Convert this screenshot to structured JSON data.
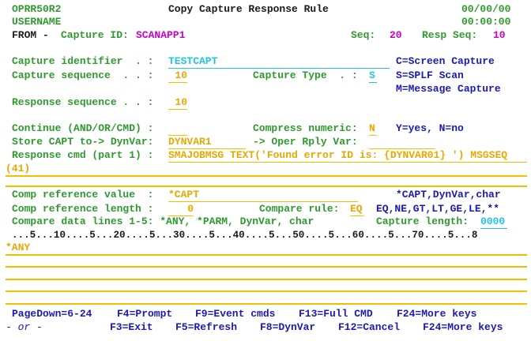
{
  "header": {
    "program": "OPRR50R2",
    "user": "USERNAME",
    "title": "Copy Capture Response Rule",
    "date": "00/00/00",
    "time": "00:00:00"
  },
  "from": {
    "label": "FROM -",
    "capture_id_label": "Capture ID:",
    "capture_id": "SCANAPP1",
    "seq_label": "Seq:",
    "seq": "20",
    "resp_seq_label": "Resp Seq:",
    "resp_seq": "10"
  },
  "fields": {
    "capture_identifier_label": "Capture identifier  . :",
    "capture_identifier": "TESTCAPT",
    "capture_sequence_label": "Capture sequence  . . :",
    "capture_sequence": "10",
    "capture_type_label": "Capture Type  . :",
    "capture_type": "S",
    "response_sequence_label": "Response sequence . . :",
    "response_sequence": "10",
    "continue_label": "Continue (AND/OR/CMD) :",
    "continue_value": "",
    "compress_label": "Compress numeric:",
    "compress_value": "N",
    "compress_hint": "Y=yes, N=no",
    "store_capt_label": "Store CAPT to-> DynVar:",
    "store_capt_value": "DYNVAR1",
    "oper_rply_label": "-> Oper Rply Var:",
    "oper_rply_value": "",
    "response_cmd_label": "Response cmd (part 1) :",
    "response_cmd_line1": "SMAJOBMSG TEXT('Found error ID is: {DYNVAR01} ') MSGSEQ",
    "response_cmd_line2": "(41)",
    "comp_ref_value_label": "Comp reference value  :",
    "comp_ref_value": "*CAPT",
    "comp_ref_value_hint": "*CAPT,DynVar,char",
    "comp_ref_length_label": "Comp reference length :",
    "comp_ref_length": "0",
    "compare_rule_label": "Compare rule:",
    "compare_rule": "EQ",
    "compare_rule_hint": "EQ,NE,GT,LT,GE,LE,**",
    "compare_lines_label": "Compare data lines 1-5: *ANY, *PARM, DynVar, char",
    "capture_length_label": "Capture length:",
    "capture_length": "0000",
    "ruler": "...5...10....5...20....5...30....5...40....5...50....5...60....5...70....5...8",
    "compare_line1": "*ANY"
  },
  "capture_type_options": {
    "c": "C=Screen Capture",
    "s": "S=SPLF Scan",
    "m": "M=Message Capture"
  },
  "function_keys": {
    "row1": [
      {
        "label": "PageDown=6-24"
      },
      {
        "label": "F4=Prompt"
      },
      {
        "label": "F9=Event cmds"
      },
      {
        "label": "F13=Full CMD"
      },
      {
        "label": "F24=More keys"
      }
    ],
    "or": "- or -",
    "row2": [
      {
        "label": "F3=Exit"
      },
      {
        "label": "F5=Refresh"
      },
      {
        "label": "F8=DynVar"
      },
      {
        "label": "F12=Cancel"
      },
      {
        "label": "F24=More keys"
      }
    ]
  }
}
